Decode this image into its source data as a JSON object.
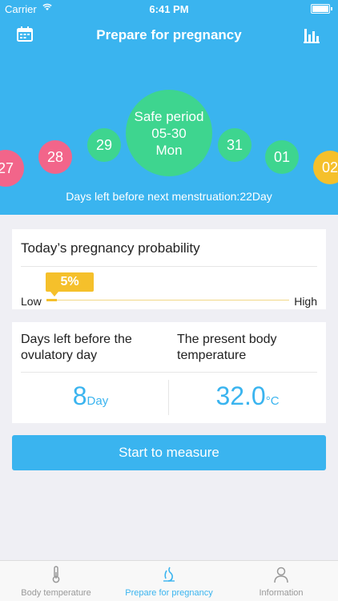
{
  "status": {
    "carrier": "Carrier",
    "time": "6:41 PM"
  },
  "nav": {
    "title": "Prepare for pregnancy"
  },
  "calendar": {
    "days": [
      "27",
      "28",
      "29",
      "31",
      "01",
      "02"
    ],
    "selected": {
      "status": "Safe period",
      "date": "05-30",
      "weekday": "Mon"
    },
    "days_left": "Days left before next menstruation:22Day"
  },
  "probability": {
    "title": "Today’s pregnancy probability",
    "value": "5%",
    "low_label": "Low",
    "high_label": "High"
  },
  "stats": {
    "ovulatory_title": "Days left before the ovulatory day",
    "ovulatory_value": "8",
    "ovulatory_unit": "Day",
    "temp_title": "The present body temperature",
    "temp_value": "32.0",
    "temp_unit": "°C"
  },
  "measure": {
    "label": "Start to measure"
  },
  "tabs": [
    {
      "label": "Body temperature"
    },
    {
      "label": "Prepare for pregnancy"
    },
    {
      "label": "Information"
    }
  ],
  "colors": {
    "primary": "#3ab4ef",
    "safe": "#3ed58f",
    "menstruation": "#f2658a",
    "ovulation": "#f5c02b"
  }
}
